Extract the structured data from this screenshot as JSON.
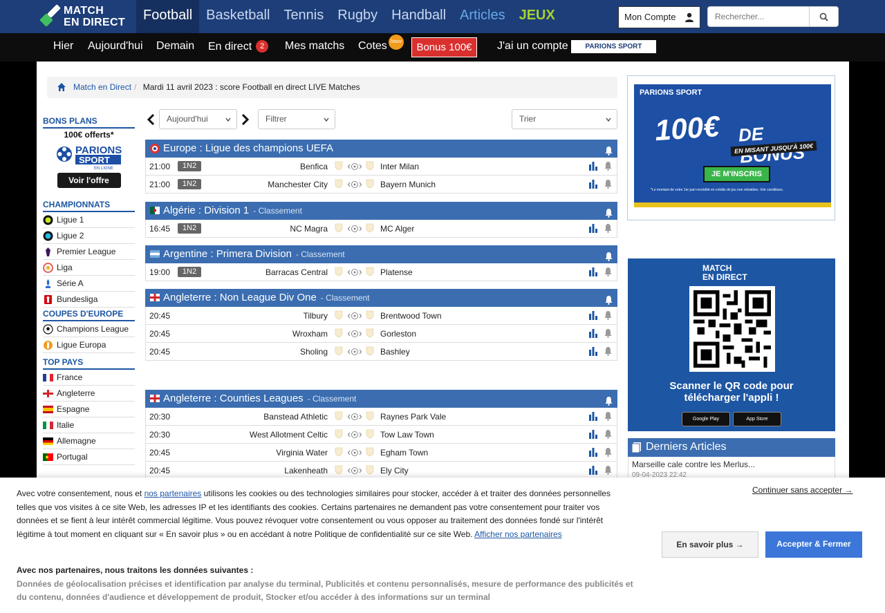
{
  "logo": {
    "line1": "MATCH",
    "line2": "EN DIRECT"
  },
  "sports": [
    {
      "label": "Football",
      "active": true
    },
    {
      "label": "Basketball"
    },
    {
      "label": "Tennis"
    },
    {
      "label": "Rugby"
    },
    {
      "label": "Handball"
    },
    {
      "label": "Articles"
    },
    {
      "label": "JEUX"
    }
  ],
  "account": {
    "label": "Mon Compte"
  },
  "search": {
    "placeholder": "Rechercher..."
  },
  "daynav": {
    "hier": "Hier",
    "aujourdhui": "Aujourd'hui",
    "demain": "Demain",
    "en_direct": "En direct",
    "live_count": "2",
    "mes_matchs": "Mes matchs",
    "cotes": "Cotes",
    "nouv": "Nouv",
    "bonus": "Bonus 100€",
    "jai_compte": "J'ai un compte",
    "parions_mini": "PARIONS SPORT"
  },
  "breadcrumb": {
    "home": "Match en Direct",
    "current": "Mardi 11 avril 2023 : score Football en direct LIVE Matches"
  },
  "sidebar": {
    "bons_plans": "BONS PLANS",
    "promo_offer": "100€ offerts*",
    "promo_brand_top": "PARIONS",
    "promo_brand_bottom": "SPORT",
    "promo_brand_sub": "EN LIGNE",
    "promo_cta": "Voir l'offre",
    "championnats_title": "CHAMPIONNATS",
    "championnats": [
      "Ligue 1",
      "Ligue 2",
      "Premier League",
      "Liga",
      "Série A",
      "Bundesliga"
    ],
    "coupes_title": "COUPES D'EUROPE",
    "coupes": [
      "Champions League",
      "Ligue Europa"
    ],
    "top_pays_title": "TOP PAYS",
    "top_pays": [
      "France",
      "Angleterre",
      "Espagne",
      "Italie",
      "Allemagne",
      "Portugal"
    ]
  },
  "filters": {
    "day": "Aujourd'hui",
    "filter": "Filtrer",
    "sort": "Trier"
  },
  "competitions": [
    {
      "country": "Europe",
      "name": "Ligue des champions UEFA",
      "classement": "",
      "matches": [
        {
          "time": "21:00",
          "odds": "1N2",
          "home": "Benfica",
          "away": "Inter Milan"
        },
        {
          "time": "21:00",
          "odds": "1N2",
          "home": "Manchester City",
          "away": "Bayern Munich"
        }
      ]
    },
    {
      "country": "Algérie",
      "name": "Division 1",
      "classement": "- Classement",
      "matches": [
        {
          "time": "16:45",
          "odds": "1N2",
          "home": "NC Magra",
          "away": "MC Alger"
        }
      ]
    },
    {
      "country": "Argentine",
      "name": "Primera Division",
      "classement": "- Classement",
      "matches": [
        {
          "time": "19:00",
          "odds": "1N2",
          "home": "Barracas Central",
          "away": "Platense"
        }
      ]
    },
    {
      "country": "Angleterre",
      "name": "Non League Div One",
      "classement": "- Classement",
      "matches": [
        {
          "time": "20:45",
          "odds": "",
          "home": "Tilbury",
          "away": "Brentwood Town"
        },
        {
          "time": "20:45",
          "odds": "",
          "home": "Wroxham",
          "away": "Gorleston"
        },
        {
          "time": "20:45",
          "odds": "",
          "home": "Sholing",
          "away": "Bashley"
        }
      ]
    },
    {
      "country": "Angleterre",
      "name": "Counties Leagues",
      "classement": "- Classement",
      "matches": [
        {
          "time": "20:30",
          "odds": "",
          "home": "Banstead Athletic",
          "away": "Raynes Park Vale"
        },
        {
          "time": "20:30",
          "odds": "",
          "home": "West Allotment Celtic",
          "away": "Tow Law Town"
        },
        {
          "time": "20:45",
          "odds": "",
          "home": "Virginia Water",
          "away": "Egham Town"
        },
        {
          "time": "20:45",
          "odds": "",
          "home": "Lakenheath",
          "away": "Ely City"
        }
      ]
    }
  ],
  "ad": {
    "brand": "PARIONS SPORT",
    "amount": "100€",
    "bonus_word": "DE BONUS",
    "sub": "EN MISANT JUSQU'À 100€",
    "cta": "JE M'INSCRIS",
    "legal": "*Le montant de votre 1er pari recrédité en crédits de jeu non retirables. Voir conditions."
  },
  "qr": {
    "logo_line1": "MATCH",
    "logo_line2": "EN DIRECT",
    "text_line1": "Scanner le QR code pour",
    "text_line2": "télécharger l'appli !",
    "google": "Google Play",
    "apple": "App Store"
  },
  "articles": {
    "title": "Derniers Articles",
    "items": [
      {
        "title": "Marseille cale contre les Merlus...",
        "date": "09-04-2023 22:42"
      }
    ]
  },
  "cookie": {
    "p1_a": "Avec votre consentement, nous et ",
    "p1_link": "nos partenaires",
    "p1_b": " utilisons les cookies ou des technologies similaires pour stocker, accéder à et traiter des données personnelles telles que vos visites à ce site Web, les adresses IP et les identifiants des cookies. Certains partenaires ne demandent pas votre consentement pour traiter vos données et se fient à leur intérêt commercial légitime. Vous pouvez révoquer votre consentement ou vous opposer au traitement des données fondé sur l'intérêt légitime à tout moment en cliquant sur « En savoir plus » ou en accédant à notre Politique de confidentialité sur ce site Web. ",
    "p1_link2": "Afficher nos partenaires",
    "partners_title": "Avec nos partenaires, nous traitons les données suivantes :",
    "partners_text": "Données de géolocalisation précises et identification par analyse du terminal, Publicités et contenu personnalisés, mesure de performance des publicités et du contenu, données d'audience et développement de produit, Stocker et/ou accéder à des informations sur un terminal",
    "continue": "Continuer sans accepter →",
    "more": "En savoir plus →",
    "accept": "Accepter & Fermer"
  },
  "colors": {
    "nav": "#1d3e78",
    "accent": "#3b6db0",
    "live": "#d9302e",
    "jeux": "#a6d130"
  }
}
